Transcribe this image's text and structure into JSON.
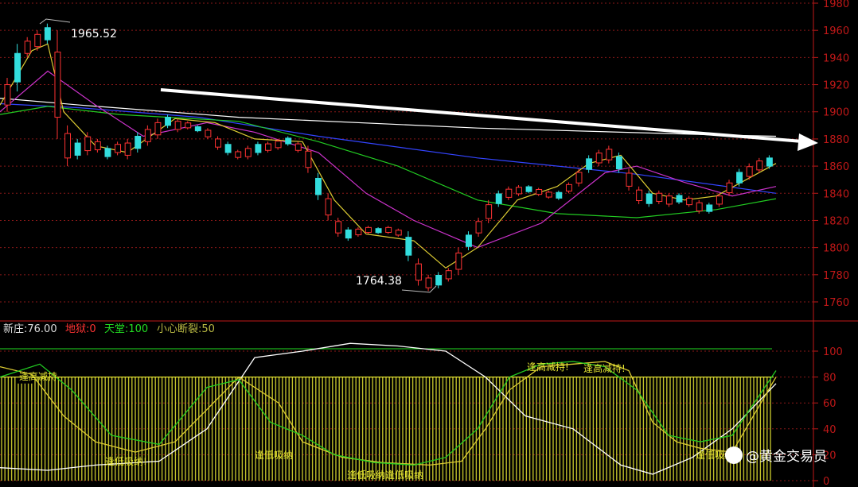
{
  "chart_data": [
    {
      "type": "candlestick",
      "title": "",
      "ylim": [
        1750,
        1980
      ],
      "y_ticks": [
        1760,
        1780,
        1800,
        1820,
        1840,
        1860,
        1880,
        1900,
        1920,
        1940,
        1960,
        1980
      ],
      "grid": true,
      "annotations": {
        "high_label": "1965.52",
        "low_label": "1764.38"
      },
      "ma_lines": [
        {
          "color": "#ffffff",
          "points": [
            [
              0,
              1910
            ],
            [
              100,
              1905
            ],
            [
              300,
              1896
            ],
            [
              600,
              1888
            ],
            [
              900,
              1883
            ],
            [
              975,
              1882
            ]
          ]
        },
        {
          "color": "#3344ff",
          "points": [
            [
              0,
              1906
            ],
            [
              100,
              1903
            ],
            [
              250,
              1896
            ],
            [
              400,
              1882
            ],
            [
              600,
              1866
            ],
            [
              800,
              1854
            ],
            [
              975,
              1840
            ]
          ]
        },
        {
          "color": "#22cc22",
          "points": [
            [
              0,
              1898
            ],
            [
              60,
              1904
            ],
            [
              150,
              1898
            ],
            [
              300,
              1893
            ],
            [
              400,
              1878
            ],
            [
              500,
              1860
            ],
            [
              600,
              1835
            ],
            [
              700,
              1825
            ],
            [
              800,
              1822
            ],
            [
              900,
              1828
            ],
            [
              975,
              1836
            ]
          ]
        },
        {
          "color": "#cc33cc",
          "points": [
            [
              0,
              1900
            ],
            [
              60,
              1930
            ],
            [
              120,
              1905
            ],
            [
              180,
              1882
            ],
            [
              260,
              1892
            ],
            [
              320,
              1885
            ],
            [
              400,
              1870
            ],
            [
              460,
              1840
            ],
            [
              520,
              1820
            ],
            [
              600,
              1800
            ],
            [
              680,
              1818
            ],
            [
              760,
              1855
            ],
            [
              800,
              1860
            ],
            [
              860,
              1848
            ],
            [
              920,
              1838
            ],
            [
              975,
              1845
            ]
          ]
        },
        {
          "color": "#ddcc33",
          "points": [
            [
              0,
              1905
            ],
            [
              40,
              1945
            ],
            [
              60,
              1950
            ],
            [
              80,
              1900
            ],
            [
              120,
              1875
            ],
            [
              160,
              1870
            ],
            [
              220,
              1895
            ],
            [
              270,
              1892
            ],
            [
              320,
              1880
            ],
            [
              380,
              1878
            ],
            [
              420,
              1835
            ],
            [
              460,
              1810
            ],
            [
              520,
              1805
            ],
            [
              560,
              1785
            ],
            [
              600,
              1800
            ],
            [
              650,
              1835
            ],
            [
              700,
              1845
            ],
            [
              740,
              1862
            ],
            [
              780,
              1868
            ],
            [
              820,
              1840
            ],
            [
              860,
              1835
            ],
            [
              900,
              1838
            ],
            [
              975,
              1862
            ]
          ]
        }
      ],
      "candles": [
        [
          1900,
          1925
        ],
        [
          1915,
          1950
        ],
        [
          1940,
          1955
        ],
        [
          1945,
          1960
        ],
        [
          1950,
          1965
        ],
        [
          1880,
          1960
        ],
        [
          1860,
          1890
        ],
        [
          1865,
          1880
        ],
        [
          1868,
          1885
        ],
        [
          1870,
          1880
        ],
        [
          1865,
          1875
        ],
        [
          1868,
          1878
        ],
        [
          1865,
          1880
        ],
        [
          1870,
          1885
        ],
        [
          1875,
          1890
        ],
        [
          1880,
          1895
        ],
        [
          1888,
          1898
        ],
        [
          1885,
          1895
        ],
        [
          1887,
          1893
        ],
        [
          1885,
          1890
        ],
        [
          1880,
          1888
        ],
        [
          1872,
          1882
        ],
        [
          1868,
          1878
        ],
        [
          1865,
          1872
        ],
        [
          1865,
          1875
        ],
        [
          1868,
          1878
        ],
        [
          1870,
          1878
        ],
        [
          1872,
          1880
        ],
        [
          1875,
          1882
        ],
        [
          1870,
          1878
        ],
        [
          1855,
          1875
        ],
        [
          1835,
          1855
        ],
        [
          1820,
          1840
        ],
        [
          1808,
          1822
        ],
        [
          1805,
          1815
        ],
        [
          1808,
          1815
        ],
        [
          1810,
          1816
        ],
        [
          1810,
          1815
        ],
        [
          1810,
          1816
        ],
        [
          1808,
          1814
        ],
        [
          1790,
          1812
        ],
        [
          1772,
          1792
        ],
        [
          1768,
          1780
        ],
        [
          1770,
          1782
        ],
        [
          1775,
          1785
        ],
        [
          1780,
          1800
        ],
        [
          1798,
          1812
        ],
        [
          1808,
          1822
        ],
        [
          1818,
          1835
        ],
        [
          1830,
          1842
        ],
        [
          1835,
          1845
        ],
        [
          1838,
          1846
        ],
        [
          1840,
          1846
        ],
        [
          1838,
          1844
        ],
        [
          1836,
          1842
        ],
        [
          1835,
          1842
        ],
        [
          1840,
          1848
        ],
        [
          1845,
          1858
        ],
        [
          1855,
          1868
        ],
        [
          1860,
          1872
        ],
        [
          1862,
          1875
        ],
        [
          1855,
          1870
        ],
        [
          1842,
          1858
        ],
        [
          1832,
          1845
        ],
        [
          1830,
          1842
        ],
        [
          1832,
          1842
        ],
        [
          1830,
          1840
        ],
        [
          1832,
          1840
        ],
        [
          1830,
          1838
        ],
        [
          1825,
          1835
        ],
        [
          1825,
          1833
        ],
        [
          1830,
          1840
        ],
        [
          1838,
          1850
        ],
        [
          1845,
          1858
        ],
        [
          1850,
          1862
        ],
        [
          1855,
          1866
        ],
        [
          1858,
          1868
        ]
      ]
    },
    {
      "type": "line",
      "ylim": [
        0,
        110
      ],
      "y_ticks": [
        0,
        20,
        40,
        60,
        80,
        100
      ],
      "indicators": [
        {
          "label": "新庄:76.00",
          "color": "#dddddd"
        },
        {
          "label": "地狱:0",
          "color": "#ff3333"
        },
        {
          "label": "天堂:100",
          "color": "#22dd22"
        },
        {
          "label": "小心断裂:50",
          "color": "#bbbb44"
        }
      ],
      "annotations": [
        {
          "text": "逢高减持",
          "x": 60
        },
        {
          "text": "逢低吸纳!",
          "x": 170
        },
        {
          "text": "逢低吸纳",
          "x": 350
        },
        {
          "text": "逢低吸纳逢低吸纳",
          "x": 505
        },
        {
          "text": "逢高减持!",
          "x": 700
        },
        {
          "text": "逢高减持!",
          "x": 765
        },
        {
          "text": "逢低吸纳!",
          "x": 905
        }
      ],
      "series": [
        {
          "color": "#ffffff",
          "points": [
            [
              0,
              10
            ],
            [
              60,
              8
            ],
            [
              120,
              12
            ],
            [
              200,
              15
            ],
            [
              260,
              40
            ],
            [
              320,
              95
            ],
            [
              380,
              100
            ],
            [
              440,
              106
            ],
            [
              500,
              104
            ],
            [
              560,
              100
            ],
            [
              610,
              80
            ],
            [
              660,
              50
            ],
            [
              720,
              40
            ],
            [
              780,
              12
            ],
            [
              820,
              5
            ],
            [
              870,
              18
            ],
            [
              920,
              40
            ],
            [
              975,
              75
            ]
          ]
        },
        {
          "color": "#ddcc33",
          "points": [
            [
              0,
              88
            ],
            [
              40,
              82
            ],
            [
              80,
              50
            ],
            [
              120,
              30
            ],
            [
              170,
              22
            ],
            [
              220,
              30
            ],
            [
              260,
              55
            ],
            [
              300,
              80
            ],
            [
              350,
              60
            ],
            [
              380,
              30
            ],
            [
              430,
              18
            ],
            [
              480,
              14
            ],
            [
              540,
              12
            ],
            [
              580,
              15
            ],
            [
              610,
              40
            ],
            [
              640,
              70
            ],
            [
              680,
              88
            ],
            [
              720,
              90
            ],
            [
              760,
              92
            ],
            [
              790,
              85
            ],
            [
              820,
              45
            ],
            [
              850,
              30
            ],
            [
              880,
              25
            ],
            [
              920,
              22
            ],
            [
              975,
              80
            ]
          ]
        },
        {
          "color": "#22cc22",
          "points": [
            [
              0,
              80
            ],
            [
              50,
              90
            ],
            [
              90,
              70
            ],
            [
              140,
              35
            ],
            [
              200,
              28
            ],
            [
              260,
              72
            ],
            [
              300,
              78
            ],
            [
              340,
              45
            ],
            [
              380,
              35
            ],
            [
              420,
              20
            ],
            [
              470,
              14
            ],
            [
              520,
              12
            ],
            [
              560,
              18
            ],
            [
              600,
              40
            ],
            [
              640,
              80
            ],
            [
              680,
              90
            ],
            [
              720,
              92
            ],
            [
              760,
              88
            ],
            [
              800,
              70
            ],
            [
              840,
              35
            ],
            [
              880,
              30
            ],
            [
              920,
              35
            ],
            [
              975,
              85
            ]
          ]
        }
      ]
    }
  ],
  "watermark": {
    "text": "@黄金交易员",
    "icon": "weibo-icon"
  }
}
